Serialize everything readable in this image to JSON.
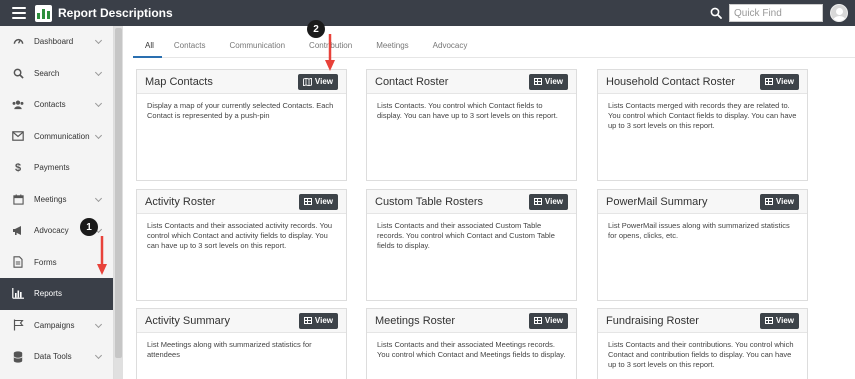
{
  "header": {
    "title": "Report Descriptions",
    "quickfind_placeholder": "Quick Find"
  },
  "sidebar": {
    "items": [
      {
        "label": "Dashboard",
        "icon": "gauge-icon",
        "chevron": true
      },
      {
        "label": "Search",
        "icon": "search-icon",
        "chevron": true
      },
      {
        "label": "Contacts",
        "icon": "users-icon",
        "chevron": true
      },
      {
        "label": "Communication",
        "icon": "envelope-icon",
        "chevron": true
      },
      {
        "label": "Payments",
        "icon": "dollar-icon",
        "chevron": false
      },
      {
        "label": "Meetings",
        "icon": "calendar-icon",
        "chevron": true
      },
      {
        "label": "Advocacy",
        "icon": "bullhorn-icon",
        "chevron": true
      },
      {
        "label": "Forms",
        "icon": "document-icon",
        "chevron": false
      },
      {
        "label": "Reports",
        "icon": "bar-chart-icon",
        "chevron": false,
        "active": true
      },
      {
        "label": "Campaigns",
        "icon": "flag-icon",
        "chevron": true
      },
      {
        "label": "Data Tools",
        "icon": "database-icon",
        "chevron": true
      }
    ]
  },
  "tabs": [
    "All",
    "Contacts",
    "Communication",
    "Contribution",
    "Meetings",
    "Advocacy"
  ],
  "active_tab": "All",
  "cards": [
    {
      "title": "Map Contacts",
      "button": "View",
      "button_icon": "map-icon",
      "description": "Display a map of your currently selected Contacts. Each Contact is represented by a push-pin"
    },
    {
      "title": "Contact Roster",
      "button": "View",
      "button_icon": "table-icon",
      "description": "Lists Contacts. You control which Contact fields to display. You can have up to 3 sort levels on this report."
    },
    {
      "title": "Household Contact Roster",
      "button": "View",
      "button_icon": "table-icon",
      "description": "Lists Contacts merged with records they are related to. You control which Contact fields to display. You can have up to 3 sort levels on this report."
    },
    {
      "title": "Activity Roster",
      "button": "View",
      "button_icon": "table-icon",
      "description": "Lists Contacts and their associated activity records. You control which Contact and activity fields to display. You can have up to 3 sort levels on this report."
    },
    {
      "title": "Custom Table Rosters",
      "button": "View",
      "button_icon": "table-icon",
      "description": "Lists Contacts and their associated Custom Table records. You control which Contact and Custom Table fields to display."
    },
    {
      "title": "PowerMail Summary",
      "button": "View",
      "button_icon": "table-icon",
      "description": "List PowerMail issues along with summarized statistics for opens, clicks, etc."
    },
    {
      "title": "Activity Summary",
      "button": "View",
      "button_icon": "table-icon",
      "description": "List Meetings along with summarized statistics for attendees"
    },
    {
      "title": "Meetings Roster",
      "button": "View",
      "button_icon": "table-icon",
      "description": "Lists Contacts and their associated Meetings records. You control which Contact and Meetings fields to display."
    },
    {
      "title": "Fundraising Roster",
      "button": "View",
      "button_icon": "table-icon",
      "description": "Lists Contacts and their contributions. You control which Contact and contribution fields to display. You can have up to 3 sort levels on this report."
    }
  ],
  "annotations": [
    {
      "label": "1",
      "color": "#1b1b1b"
    },
    {
      "label": "2",
      "color": "#1b1b1b"
    }
  ],
  "colors": {
    "topbar": "#3a3f48",
    "active_tab_underline": "#2a6fb0",
    "view_button": "#3d4349",
    "arrow": "#e8423a"
  }
}
